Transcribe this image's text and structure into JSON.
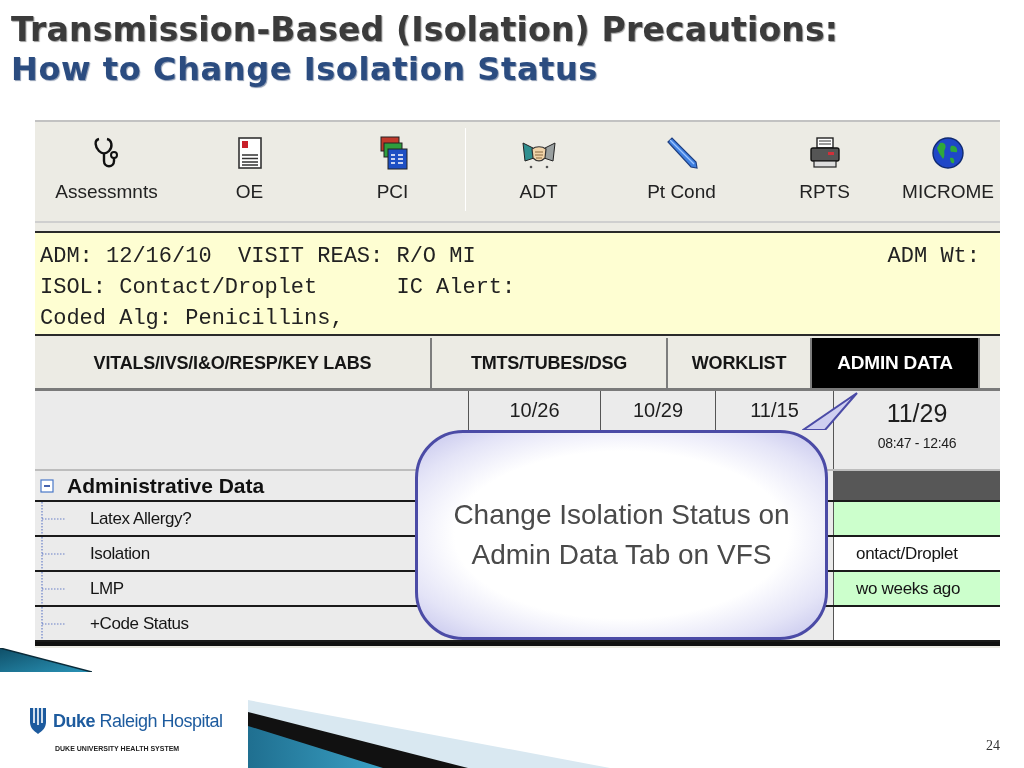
{
  "slide": {
    "title": "Transmission-Based (Isolation) Precautions:",
    "subtitle": "How to Change Isolation Status",
    "page_number": "24"
  },
  "toolbar": {
    "groups": [
      [
        {
          "label": "Assessmnts",
          "kind": "stethoscope"
        },
        {
          "label": "OE",
          "kind": "document"
        },
        {
          "label": "PCI",
          "kind": "windows"
        }
      ],
      [
        {
          "label": "ADT",
          "kind": "handshake"
        },
        {
          "label": "Pt Cond",
          "kind": "pencil"
        },
        {
          "label": "RPTS",
          "kind": "printer"
        },
        {
          "label": "MICROME",
          "kind": "globe"
        }
      ]
    ]
  },
  "banner": {
    "rows": [
      {
        "text": "ADM: 12/16/10  VISIT REAS: R/O MI",
        "right": "ADM Wt:"
      },
      {
        "text": "ISOL: Contact/Droplet      IC Alert:"
      },
      {
        "text": "Coded Alg: Penicillins,"
      }
    ]
  },
  "tabs": [
    {
      "label": "VITALS/IVS/I&O/RESP/KEY LABS",
      "selected": false
    },
    {
      "label": "TMTS/TUBES/DSG",
      "selected": false
    },
    {
      "label": "WORKLIST",
      "selected": false
    },
    {
      "label": "ADMIN DATA",
      "selected": true
    }
  ],
  "grid": {
    "columns": [
      {
        "date": "10/26"
      },
      {
        "date": "10/29"
      },
      {
        "date": "11/15"
      },
      {
        "date": "11/29",
        "time": "08:47 - 12:46"
      }
    ],
    "sections": [
      {
        "label": "Administrative Data",
        "expanded": true,
        "children": [
          {
            "label": "Latex Allergy?",
            "color": "#ccffcc"
          },
          {
            "label": "Isolation",
            "value": "ontact/Droplet",
            "color": "#ffffff"
          },
          {
            "label": "LMP",
            "value": "wo weeks ago",
            "color": "#ccffcc"
          },
          {
            "label": "+Code Status",
            "color": "#ffffff"
          }
        ]
      }
    ]
  },
  "callout": {
    "lines": [
      "Change Isolation Status on",
      "Admin Data Tab on VFS"
    ]
  },
  "logo": {
    "name": "**Duke** Raleigh Hospital",
    "tagline": "DUKE UNIVERSITY HEALTH SYSTEM"
  }
}
